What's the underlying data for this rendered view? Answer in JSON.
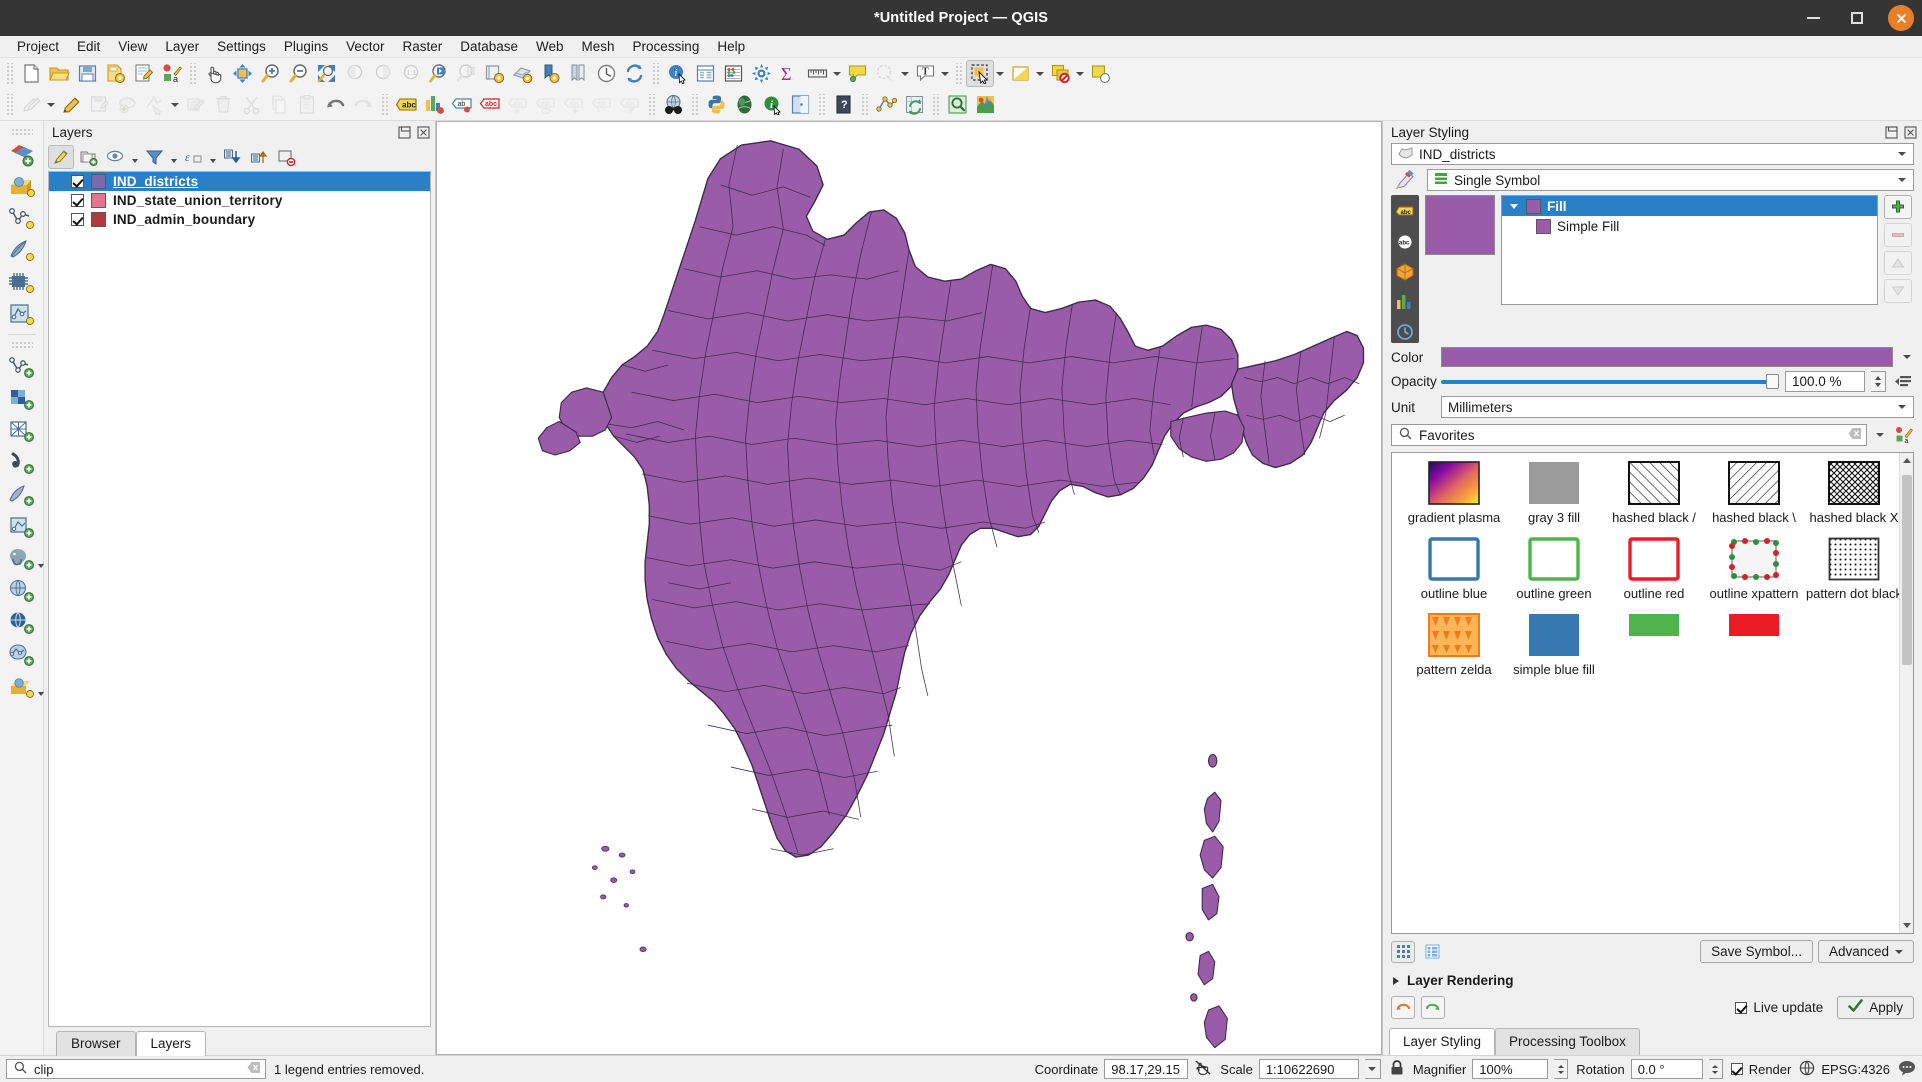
{
  "window": {
    "title": "*Untitled Project — QGIS",
    "minimize_label": "Minimize",
    "maximize_label": "Maximize",
    "close_label": "Close"
  },
  "menubar": {
    "items": [
      {
        "label": "Project"
      },
      {
        "label": "Edit"
      },
      {
        "label": "View"
      },
      {
        "label": "Layer"
      },
      {
        "label": "Settings"
      },
      {
        "label": "Plugins"
      },
      {
        "label": "Vector"
      },
      {
        "label": "Raster"
      },
      {
        "label": "Database"
      },
      {
        "label": "Web"
      },
      {
        "label": "Mesh"
      },
      {
        "label": "Processing"
      },
      {
        "label": "Help"
      }
    ]
  },
  "layers_panel": {
    "title": "Layers",
    "tabs": [
      {
        "label": "Browser",
        "active": false
      },
      {
        "label": "Layers",
        "active": true
      }
    ],
    "items": [
      {
        "name": "IND_districts",
        "color": "#7b6aa8",
        "checked": true,
        "selected": true
      },
      {
        "name": "IND_state_union_territory",
        "color": "#e8738f",
        "checked": true,
        "selected": false
      },
      {
        "name": "IND_admin_boundary",
        "color": "#b33a3a",
        "checked": true,
        "selected": false
      }
    ]
  },
  "styling_panel": {
    "title": "Layer Styling",
    "layer_combo": "IND_districts",
    "renderer_combo": "Single Symbol",
    "symbol_tree": [
      {
        "label": "Fill",
        "selected": true,
        "indent": 0
      },
      {
        "label": "Simple Fill",
        "selected": false,
        "indent": 1
      }
    ],
    "color_label": "Color",
    "color_value": "#9a5ca8",
    "opacity_label": "Opacity",
    "opacity_value": "100.0 %",
    "unit_label": "Unit",
    "unit_value": "Millimeters",
    "search_value": "Favorites",
    "save_symbol_label": "Save Symbol...",
    "advanced_label": "Advanced",
    "layer_rendering_label": "Layer Rendering",
    "live_update_label": "Live update",
    "apply_label": "Apply",
    "gallery": [
      {
        "name": "gradient plasma",
        "kind": "gradient-plasma"
      },
      {
        "name": "gray 3 fill",
        "kind": "solid",
        "color": "#9b9b9b"
      },
      {
        "name": "hashed black /",
        "kind": "hatch-fwd"
      },
      {
        "name": "hashed black \\",
        "kind": "hatch-back"
      },
      {
        "name": "hashed black X",
        "kind": "hatch-cross"
      },
      {
        "name": "outline blue",
        "kind": "outline",
        "color": "#3878b0"
      },
      {
        "name": "outline green",
        "kind": "outline",
        "color": "#4eb54e"
      },
      {
        "name": "outline red",
        "kind": "outline",
        "color": "#ec1c24"
      },
      {
        "name": "outline xpattern",
        "kind": "xpattern"
      },
      {
        "name": "pattern dot black",
        "kind": "dots"
      },
      {
        "name": "pattern zelda",
        "kind": "zelda"
      },
      {
        "name": "simple blue fill",
        "kind": "solid",
        "color": "#3878b0"
      },
      {
        "name": "",
        "kind": "solid",
        "color": "#4eb54e"
      },
      {
        "name": "",
        "kind": "solid",
        "color": "#ec1c24"
      }
    ],
    "tabs": [
      {
        "label": "Layer Styling",
        "active": true
      },
      {
        "label": "Processing Toolbox",
        "active": false
      }
    ]
  },
  "statusbar": {
    "search_value": "clip",
    "message": "1 legend entries removed.",
    "coordinate_label": "Coordinate",
    "coordinate_value": "98.17,29.15",
    "scale_label": "Scale",
    "scale_value": "1:10622690",
    "magnifier_label": "Magnifier",
    "magnifier_value": "100%",
    "rotation_label": "Rotation",
    "rotation_value": "0.0 °",
    "render_label": "Render",
    "crs_value": "EPSG:4326"
  },
  "map": {
    "fill_color": "#9a5ca8",
    "stroke_color": "#3b2a4a",
    "background": "#ffffff"
  },
  "toolbar_row1": [
    {
      "icon": "new-project-icon"
    },
    {
      "icon": "open-project-icon"
    },
    {
      "icon": "save-project-icon"
    },
    {
      "icon": "save-project-as-icon"
    },
    {
      "icon": "new-print-layout-icon"
    },
    {
      "icon": "style-manager-icon"
    },
    {
      "icon": "pan-map-icon"
    },
    {
      "icon": "pan-to-selection-icon"
    },
    {
      "icon": "zoom-in-icon"
    },
    {
      "icon": "zoom-out-icon"
    },
    {
      "icon": "zoom-full-icon"
    },
    {
      "icon": "zoom-to-selection-icon"
    },
    {
      "icon": "zoom-to-layer-icon"
    },
    {
      "icon": "zoom-native-icon"
    },
    {
      "icon": "zoom-last-icon"
    },
    {
      "icon": "zoom-next-icon"
    },
    {
      "icon": "new-map-view-icon"
    },
    {
      "icon": "new-3d-map-view-icon"
    },
    {
      "icon": "new-print-layout2-icon"
    },
    {
      "icon": "layout-manager-icon"
    },
    {
      "icon": "temporal-controller-icon"
    },
    {
      "icon": "refresh-icon"
    },
    {
      "icon": "identify-features-icon"
    },
    {
      "icon": "open-attribute-table-icon"
    },
    {
      "icon": "field-calculator-icon"
    },
    {
      "icon": "processing-options-icon"
    },
    {
      "icon": "statistical-summary-icon"
    },
    {
      "icon": "measure-line-icon"
    },
    {
      "icon": "map-tips-icon"
    },
    {
      "icon": "show-unplaced-labels-icon"
    },
    {
      "icon": "new-text-annotation-icon"
    },
    {
      "icon": "select-features-icon"
    },
    {
      "icon": "deselect-icon"
    },
    {
      "icon": "select-by-expression-icon"
    },
    {
      "icon": "select-value-icon"
    }
  ],
  "toolbar_row2": [
    {
      "icon": "current-edits-icon"
    },
    {
      "icon": "toggle-editing-icon"
    },
    {
      "icon": "save-layer-edits-icon"
    },
    {
      "icon": "add-feature-icon"
    },
    {
      "icon": "vertex-tool-icon"
    },
    {
      "icon": "modify-attributes-icon"
    },
    {
      "icon": "delete-selected-icon"
    },
    {
      "icon": "cut-features-icon"
    },
    {
      "icon": "copy-features-icon"
    },
    {
      "icon": "paste-features-icon"
    },
    {
      "icon": "undo-icon"
    },
    {
      "icon": "redo-icon"
    },
    {
      "icon": "label-toolbar-icon"
    },
    {
      "icon": "diagram-icon"
    },
    {
      "icon": "highlight-pinned-labels-icon"
    },
    {
      "icon": "pin-labels-icon"
    },
    {
      "icon": "move-label-icon"
    },
    {
      "icon": "show-hide-labels-icon"
    },
    {
      "icon": "change-label-icon"
    },
    {
      "icon": "rotate-label-icon"
    },
    {
      "icon": "edit-label-icon"
    },
    {
      "icon": "metasearch-icon"
    },
    {
      "icon": "python-console-icon"
    },
    {
      "icon": "plugin-manager-icon"
    },
    {
      "icon": "identify-plugin-icon"
    },
    {
      "icon": "open-data-source-icon"
    },
    {
      "icon": "help-icon"
    },
    {
      "icon": "geoprocessing-icon"
    },
    {
      "icon": "refresh-plugin-icon"
    },
    {
      "icon": "search-plugin-icon"
    },
    {
      "icon": "qgis2web-icon"
    }
  ],
  "vtoolbar": [
    {
      "icon": "add-layers-icon"
    },
    {
      "icon": "add-raster-layer-icon"
    },
    {
      "icon": "add-vector-layer-icon"
    },
    {
      "icon": "add-mesh-layer-icon"
    },
    {
      "icon": "add-delimited-text-icon"
    },
    {
      "icon": "add-spatialite-icon"
    },
    {
      "icon": "new-shapefile-icon"
    },
    {
      "icon": "new-geopackage-icon"
    },
    {
      "icon": "new-virtual-layer-icon"
    },
    {
      "icon": "new-spatialite-icon"
    },
    {
      "icon": "new-mesh-icon"
    },
    {
      "icon": "new-gpx-icon"
    },
    {
      "icon": "add-postgis-icon"
    },
    {
      "icon": "add-wms-icon"
    },
    {
      "icon": "add-wfs-icon"
    },
    {
      "icon": "add-wcs-icon"
    },
    {
      "icon": "add-arcgis-icon"
    }
  ]
}
